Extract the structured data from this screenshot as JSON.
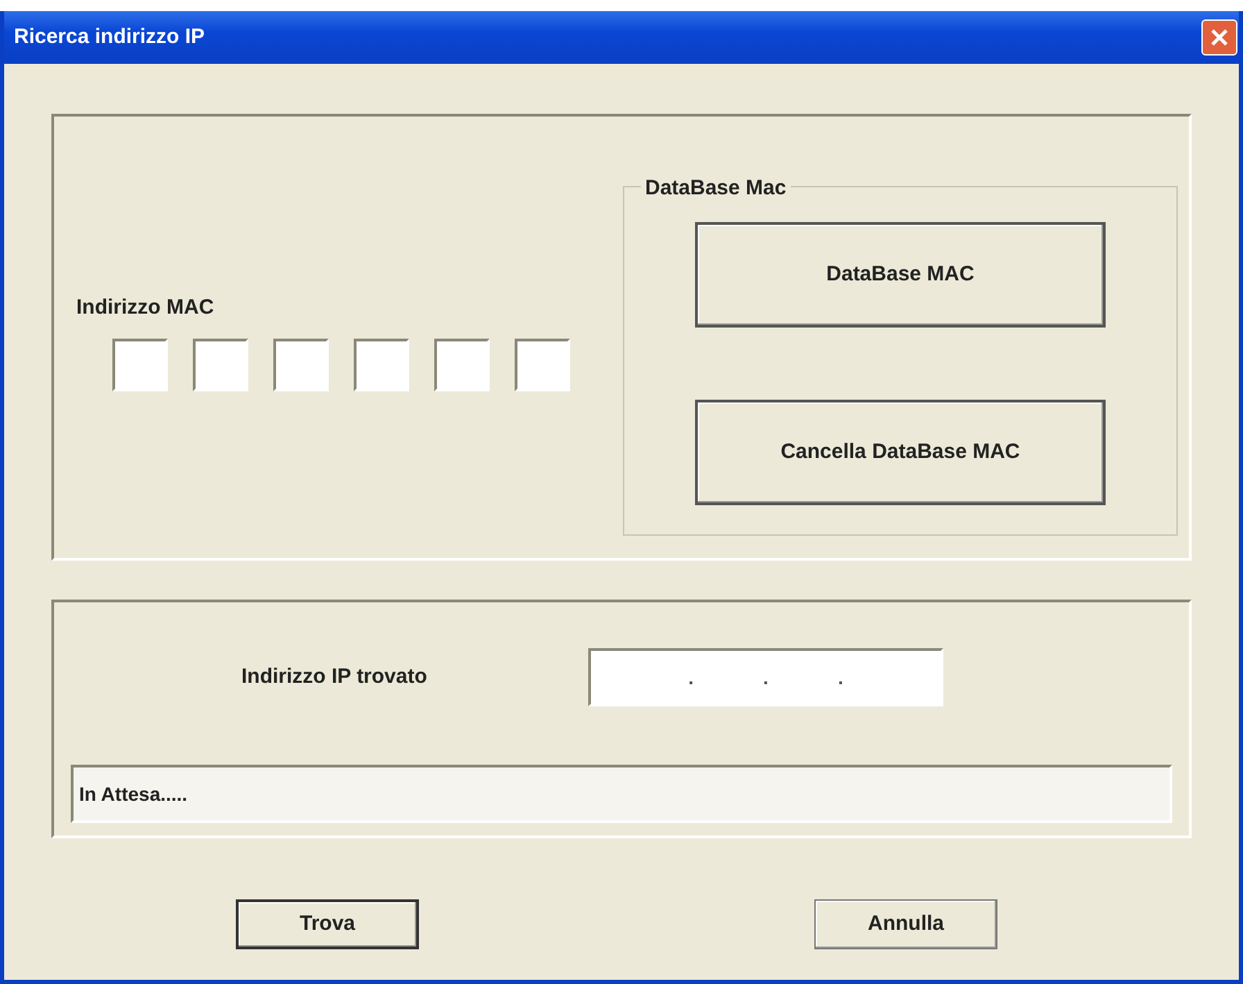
{
  "window": {
    "title": "Ricerca indirizzo IP"
  },
  "mac": {
    "label": "Indirizzo MAC",
    "fields": [
      {
        "kind": "octet"
      },
      {
        "kind": "octet"
      },
      {
        "kind": "octet"
      },
      {
        "kind": "octet"
      },
      {
        "kind": "octet"
      },
      {
        "kind": "octet"
      }
    ]
  },
  "database_group": {
    "legend": "DataBase Mac",
    "buttons": [
      "DataBase MAC",
      "Cancella DataBase MAC"
    ]
  },
  "result": {
    "label": "Indirizzo IP trovato",
    "ip_separators": [
      ".",
      ".",
      "."
    ],
    "status": "In Attesa....."
  },
  "buttons": [
    "Trova",
    "Annulla"
  ]
}
